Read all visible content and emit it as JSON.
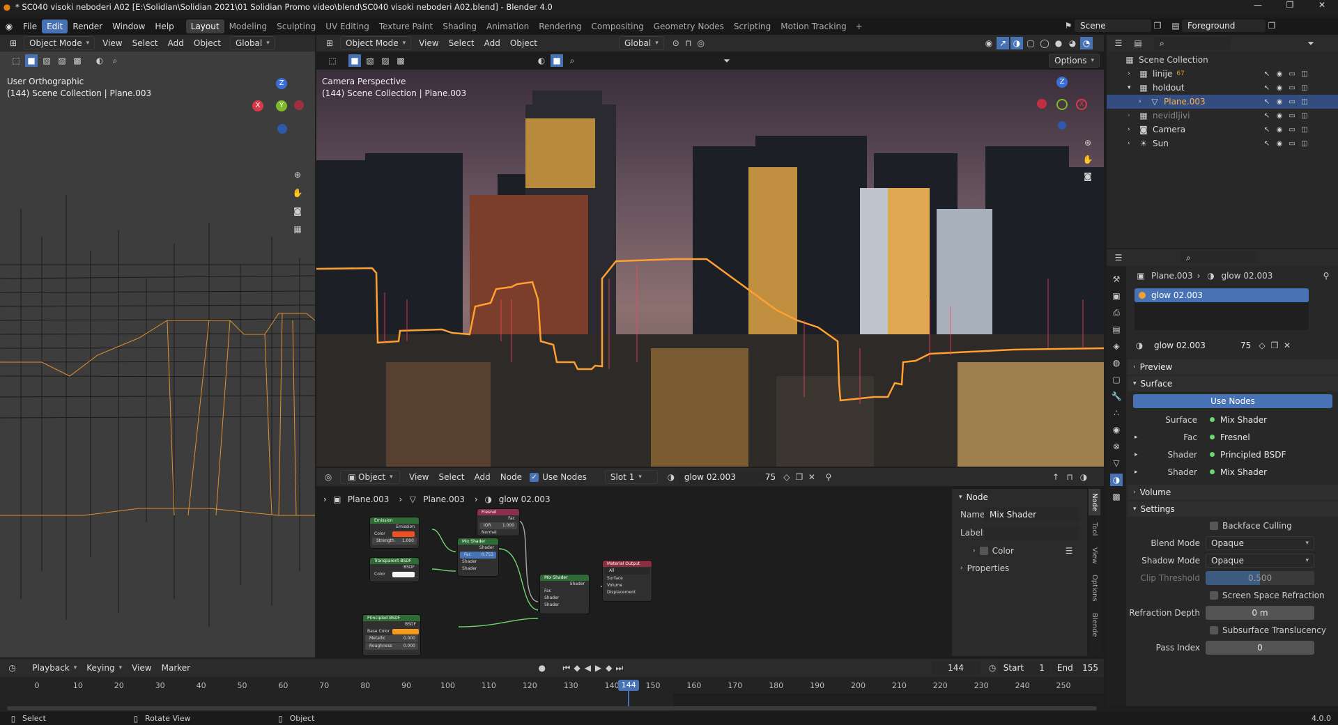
{
  "window": {
    "title": "* SC040 visoki neboderi A02 [E:\\Solidian\\Solidian 2021\\01 Solidian Promo video\\blend\\SC040 visoki neboderi A02.blend] - Blender 4.0"
  },
  "menu": [
    "File",
    "Edit",
    "Render",
    "Window",
    "Help"
  ],
  "workspaces": [
    "Layout",
    "Modeling",
    "Sculpting",
    "UV Editing",
    "Texture Paint",
    "Shading",
    "Animation",
    "Rendering",
    "Compositing",
    "Geometry Nodes",
    "Scripting",
    "Motion Tracking"
  ],
  "scene": {
    "name": "Scene",
    "view_layer": "Foreground"
  },
  "left_view": {
    "mode": "Object Mode",
    "menus": [
      "View",
      "Select",
      "Add",
      "Object"
    ],
    "orientation": "Global",
    "title": "User Orthographic",
    "subtitle": "(144) Scene Collection | Plane.003",
    "axes": {
      "z": "Z",
      "y": "Y",
      "x": "X"
    }
  },
  "cam_view": {
    "mode": "Object Mode",
    "menus": [
      "View",
      "Select",
      "Add",
      "Object"
    ],
    "orientation": "Global",
    "options": "Options",
    "title": "Camera Perspective",
    "subtitle": "(144) Scene Collection | Plane.003",
    "axes": {
      "z": "Z",
      "x": "X"
    }
  },
  "outliner": {
    "root": "Scene Collection",
    "items": [
      {
        "name": "linije",
        "badge": "67"
      },
      {
        "name": "holdout"
      },
      {
        "name": "Plane.003"
      },
      {
        "name": "nevidljivi"
      },
      {
        "name": "Camera"
      },
      {
        "name": "Sun"
      }
    ]
  },
  "node_editor": {
    "type": "Object",
    "menus": [
      "View",
      "Select",
      "Add",
      "Node"
    ],
    "use_nodes": "Use Nodes",
    "slot": "Slot 1",
    "material": "glow 02.003",
    "users": "75",
    "breadcrumb": [
      "Plane.003",
      "Plane.003",
      "glow 02.003"
    ],
    "panel": {
      "title": "Node",
      "name_label": "Name:",
      "name": "Mix Shader",
      "label_label": "Label:",
      "color": "Color",
      "properties": "Properties"
    },
    "tabs": [
      "Node",
      "Tool",
      "View",
      "Options",
      "Blende"
    ],
    "nodes": {
      "emission": {
        "title": "Emission",
        "out": "Emission",
        "color": "Color",
        "strength": "Strength",
        "strength_val": "1.000"
      },
      "transparent": {
        "title": "Transparent BSDF",
        "out": "BSDF",
        "color": "Color"
      },
      "mix1": {
        "title": "Mix Shader",
        "out": "Shader",
        "fac": "Fac",
        "fac_val": "0.753",
        "s1": "Shader",
        "s2": "Shader"
      },
      "fresnel": {
        "title": "Fresnel",
        "out": "Fac",
        "ior": "IOR",
        "ior_val": "1.000",
        "normal": "Normal"
      },
      "mix2": {
        "title": "Mix Shader",
        "out": "Shader",
        "fac": "Fac",
        "s1": "Shader",
        "s2": "Shader"
      },
      "output": {
        "title": "Material Output",
        "target": "All",
        "surface": "Surface",
        "volume": "Volume",
        "displacement": "Displacement"
      },
      "principled": {
        "title": "Principled BSDF",
        "out": "BSDF",
        "base": "Base Color",
        "metallic": "Metallic",
        "metallic_val": "0.000",
        "roughness": "Roughness",
        "roughness_val": "0.000"
      }
    }
  },
  "properties": {
    "object": "Plane.003",
    "material": "glow 02.003",
    "slot_item": "glow 02.003",
    "mat_field": "glow 02.003",
    "users": "75",
    "preview": "Preview",
    "surface": "Surface",
    "use_nodes": "Use Nodes",
    "surface_rows": [
      {
        "label": "Surface",
        "value": "Mix Shader"
      },
      {
        "label": "Fac",
        "value": "Fresnel"
      },
      {
        "label": "Shader",
        "value": "Principled BSDF"
      },
      {
        "label": "Shader",
        "value": "Mix Shader"
      }
    ],
    "volume": "Volume",
    "settings": "Settings",
    "backface": "Backface Culling",
    "blend_label": "Blend Mode",
    "blend": "Opaque",
    "shadow_label": "Shadow Mode",
    "shadow": "Opaque",
    "clip_label": "Clip Threshold",
    "clip": "0.500",
    "ssr": "Screen Space Refraction",
    "rdepth_label": "Refraction Depth",
    "rdepth": "0 m",
    "subsurf": "Subsurface Translucency",
    "pass_label": "Pass Index",
    "pass": "0"
  },
  "timeline": {
    "menus": [
      "Playback",
      "Keying",
      "View",
      "Marker"
    ],
    "frame": "144",
    "start_label": "Start",
    "start": "1",
    "end_label": "End",
    "end": "155",
    "ticks": [
      "0",
      "10",
      "20",
      "30",
      "40",
      "50",
      "60",
      "70",
      "80",
      "90",
      "100",
      "110",
      "120",
      "130",
      "140",
      "150",
      "160",
      "170",
      "180",
      "190",
      "200",
      "210",
      "220",
      "230",
      "240",
      "250"
    ],
    "current": "144"
  },
  "status": {
    "select": "Select",
    "rotate": "Rotate View",
    "object": "Object",
    "version": "4.0.0"
  },
  "colors": {
    "accent": "#4772b3",
    "orange": "#f5a030",
    "header": "#303030",
    "bg": "#1d1d1d"
  }
}
